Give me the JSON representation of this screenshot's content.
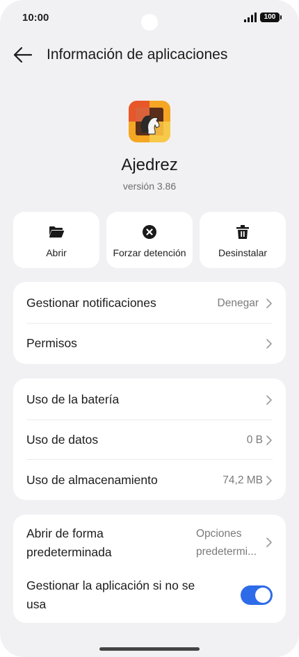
{
  "status_bar": {
    "time": "10:00",
    "battery": "100"
  },
  "header": {
    "title": "Información de aplicaciones"
  },
  "app": {
    "name": "Ajedrez",
    "version": "versión 3.86"
  },
  "actions": [
    {
      "label": "Abrir",
      "icon": "folder-open-icon"
    },
    {
      "label": "Forzar detención",
      "icon": "stop-circle-icon"
    },
    {
      "label": "Desinstalar",
      "icon": "trash-icon"
    }
  ],
  "notifications_card": {
    "manage_notifications": {
      "label": "Gestionar notificaciones",
      "value": "Denegar"
    },
    "permissions": {
      "label": "Permisos"
    }
  },
  "usage_card": {
    "battery": {
      "label": "Uso de la batería"
    },
    "data": {
      "label": "Uso de datos",
      "value": "0 B"
    },
    "storage": {
      "label": "Uso de almacenamiento",
      "value": "74,2 MB"
    }
  },
  "defaults_card": {
    "open_default": {
      "label_line1": "Abrir de forma",
      "label_line2": "predeterminada",
      "value_line1": "Opciones",
      "value_line2": "predetermi..."
    },
    "manage_unused": {
      "label_line1": "Gestionar la aplicación si no se",
      "label_line2": "usa",
      "enabled": true
    }
  },
  "colors": {
    "accent": "#2d6be8",
    "background": "#f1f1f3",
    "card": "#ffffff"
  }
}
